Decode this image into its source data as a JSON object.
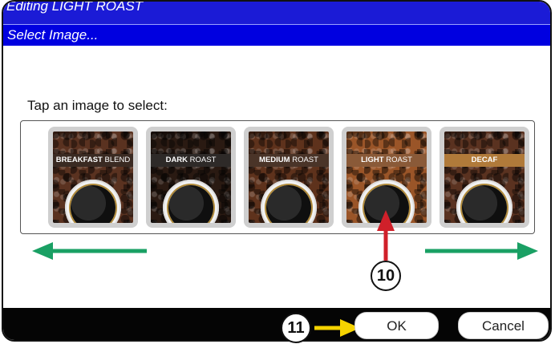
{
  "window": {
    "title": "Editing LIGHT ROAST",
    "subtitle": "Select Image..."
  },
  "prompt": "Tap an image to select:",
  "images": [
    {
      "bold": "BREAKFAST",
      "rest": " BLEND",
      "band_color": "#3a2a22",
      "bean_color": "#5a3220"
    },
    {
      "bold": "DARK",
      "rest": " ROAST",
      "band_color": "#2e2a28",
      "bean_color": "#2a1a12"
    },
    {
      "bold": "MEDIUM",
      "rest": " ROAST",
      "band_color": "#4a3428",
      "bean_color": "#5e321c"
    },
    {
      "bold": "LIGHT",
      "rest": " ROAST",
      "band_color": "#8a5a38",
      "bean_color": "#9a5528"
    },
    {
      "bold": "DECAF",
      "rest": "",
      "band_color": "#b07a3a",
      "bean_color": "#5a3220"
    }
  ],
  "buttons": {
    "ok": "OK",
    "cancel": "Cancel"
  },
  "callouts": {
    "ten": "10",
    "eleven": "11"
  },
  "colors": {
    "title_bar": "#1b1bd6",
    "scroll_arrows": "#1aa064",
    "pointer_red": "#d0202a",
    "pointer_yellow": "#f5d300"
  },
  "icons": [
    "scroll-left-arrow-icon",
    "scroll-right-arrow-icon",
    "pointer-arrow-icon"
  ]
}
